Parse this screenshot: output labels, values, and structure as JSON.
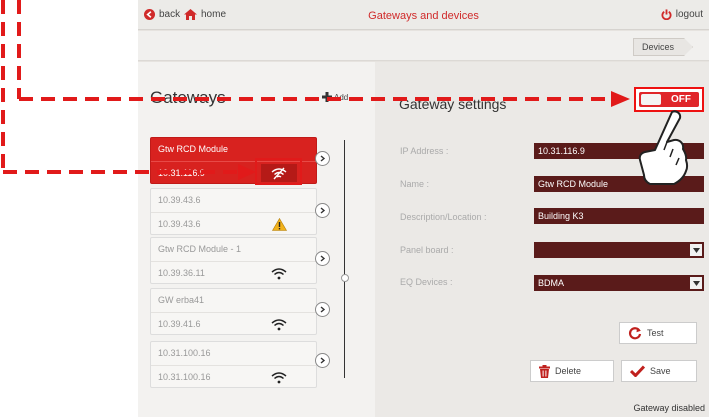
{
  "topbar": {
    "back_label": "back",
    "home_label": "home",
    "title": "Gateways and devices",
    "logout_label": "logout"
  },
  "breadcrumb": {
    "current": "Devices"
  },
  "gateways": {
    "title": "Gateways",
    "add_label": "Add",
    "items": [
      {
        "name": "Gtw RCD Module",
        "ip": "10.31.116.9",
        "status": "wifi-off",
        "active": true
      },
      {
        "name": "10.39.43.6",
        "ip": "10.39.43.6",
        "status": "warning",
        "active": false
      },
      {
        "name": "Gtw RCD Module - 1",
        "ip": "10.39.36.11",
        "status": "wifi",
        "active": false
      },
      {
        "name": "GW erba41",
        "ip": "10.39.41.6",
        "status": "wifi",
        "active": false
      },
      {
        "name": "10.31.100.16",
        "ip": "10.31.100.16",
        "status": "wifi",
        "active": false
      }
    ]
  },
  "settings": {
    "title": "Gateway settings",
    "toggle_label": "OFF",
    "ip_label": "IP Address :",
    "ip_value": "10.31.116.9",
    "name_label": "Name :",
    "name_value": "Gtw RCD Module",
    "desc_label": "Description/Location :",
    "desc_value": "Building K3",
    "panel_label": "Panel board :",
    "panel_value": "",
    "eq_label": "EQ Devices :",
    "eq_value": "BDMA",
    "test_label": "Test",
    "delete_label": "Delete",
    "save_label": "Save"
  },
  "status_text": "Gateway disabled",
  "colors": {
    "accent": "#d8221f",
    "field_bg": "#5a1b1a",
    "annotation": "#e11a1a"
  }
}
